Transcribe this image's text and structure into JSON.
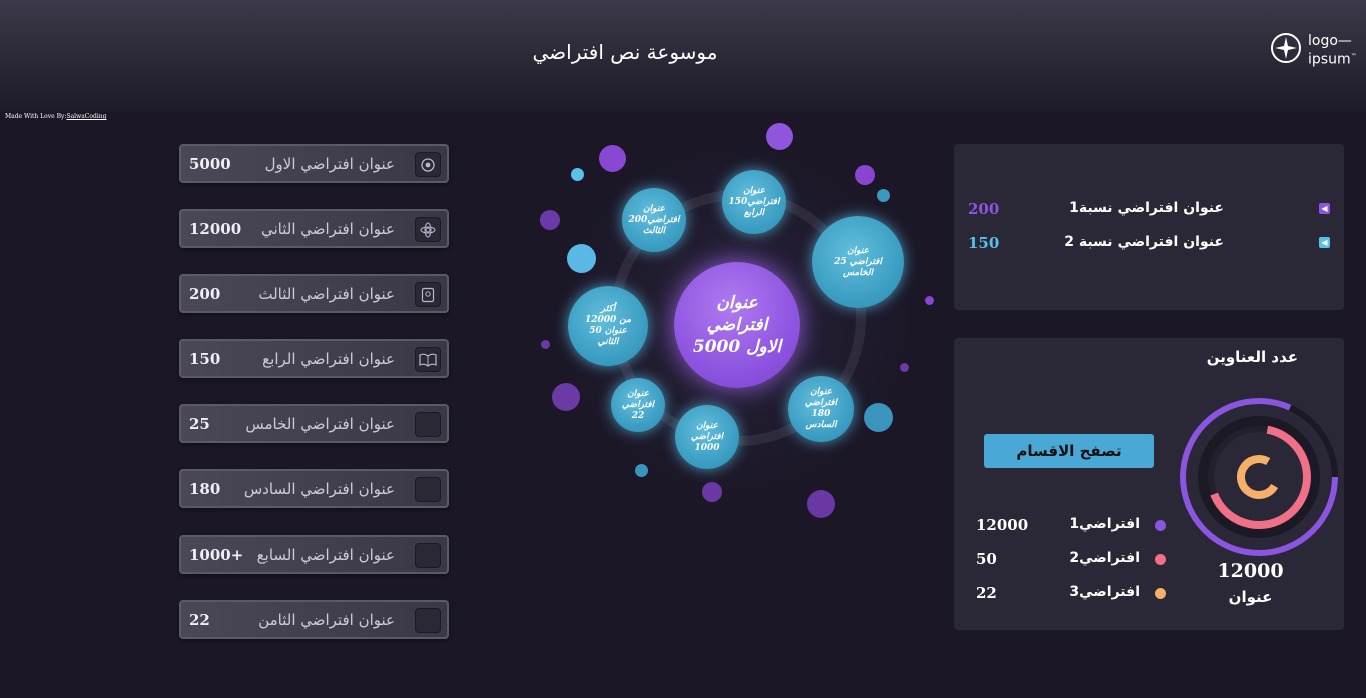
{
  "header": {
    "title": "موسوعة نص افتراضي",
    "logo_line1": "logo",
    "logo_line2": "ipsum"
  },
  "credit": {
    "prefix": "Made With Love By:",
    "author": "SalwaCoding"
  },
  "list": [
    {
      "label": "عنوان افتراضي الاول",
      "value": "5000",
      "icon": "settings-badge-icon"
    },
    {
      "label": "عنوان افتراضي الثاني",
      "value": "12000",
      "icon": "flower-icon"
    },
    {
      "label": "عنوان افتراضي الثالث",
      "value": "200",
      "icon": "book-icon"
    },
    {
      "label": "عنوان افتراضي الرابع",
      "value": "150",
      "icon": "open-book-icon"
    },
    {
      "label": "عنوان افتراضي الخامس",
      "value": "25",
      "icon": "blank-icon"
    },
    {
      "label": "عنوان افتراضي السادس",
      "value": "180",
      "icon": "blank-icon"
    },
    {
      "label": "عنوان افتراضي السابع",
      "value": "1000+",
      "icon": "blank-icon"
    },
    {
      "label": "عنوان افتراضي الثامن",
      "value": "22",
      "icon": "blank-icon"
    }
  ],
  "bubbles": {
    "center": "عنوان\nافتراضي\nالاول 5000",
    "b_200": "عنوان\nافتراضي200\nالثالث",
    "b_150": "عنوان\nافتراضي150\nالرابع",
    "b_25": "عنوان\nافتراضي 25\nالخامس",
    "b_12000": "أكثر\nمن 12000\nعنوان 50\nالثاني",
    "b_22": "عنوان\nافتراضي\n22",
    "b_1000": "عنوان\nافتراضي\n1000",
    "b_180": "عنوان\nافتراضي 180\nالسادس"
  },
  "ratios": [
    {
      "label": "عنوان افتراضي نسبة1",
      "value": "200",
      "color": "#8b55e0",
      "icon": "caret-left-icon"
    },
    {
      "label": "عنوان افتراضي نسبة 2",
      "value": "150",
      "color": "#5bc0e8",
      "icon": "caret-left-icon"
    }
  ],
  "count_panel": {
    "title": "عدد العناوين",
    "browse_label": "تصفح الاقسام",
    "total": "12000",
    "total_label": "عنوان",
    "series": [
      {
        "label": "افتراضي1",
        "value": "12000",
        "color": "#8b55e0"
      },
      {
        "label": "افتراضي2",
        "value": "50",
        "color": "#f07088"
      },
      {
        "label": "افتراضي3",
        "value": "22",
        "color": "#f5b06a"
      }
    ]
  }
}
